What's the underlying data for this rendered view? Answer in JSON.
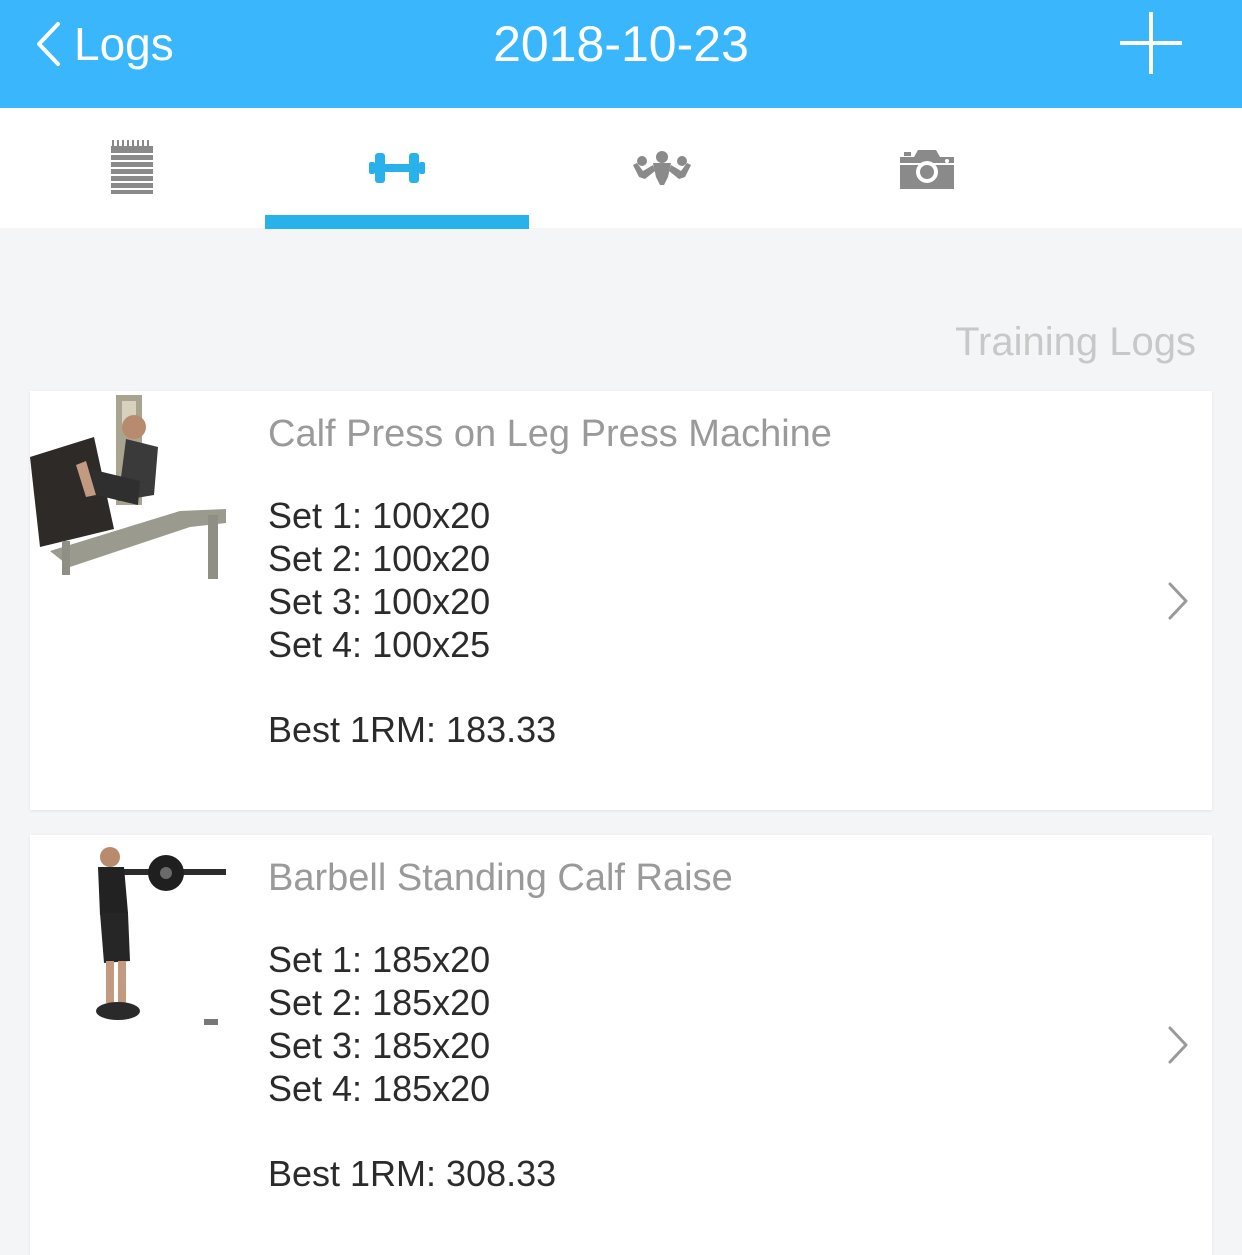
{
  "navbar": {
    "back_label": "Logs",
    "title": "2018-10-23",
    "back_icon": "chevron-left-icon",
    "add_icon": "plus-icon",
    "color": "#3ab6fd"
  },
  "tabs": [
    {
      "icon": "notepad-icon",
      "active": false
    },
    {
      "icon": "dumbbell-icon",
      "active": true
    },
    {
      "icon": "flexing-muscle-icon",
      "active": false
    },
    {
      "icon": "camera-icon",
      "active": false
    }
  ],
  "accent_color": "#28b1ea",
  "section_heading": "Training Logs",
  "logs": [
    {
      "name": "Calf Press on Leg Press Machine",
      "sets": [
        "Set 1: 100x20",
        "Set 2: 100x20",
        "Set 3: 100x20",
        "Set 4: 100x25"
      ],
      "best": "Best 1RM: 183.33",
      "image": "leg-press-machine-photo"
    },
    {
      "name": "Barbell Standing Calf Raise",
      "sets": [
        "Set 1: 185x20",
        "Set 2: 185x20",
        "Set 3: 185x20",
        "Set 4: 185x20"
      ],
      "best": "Best 1RM: 308.33",
      "image": "barbell-calf-raise-photo"
    }
  ]
}
